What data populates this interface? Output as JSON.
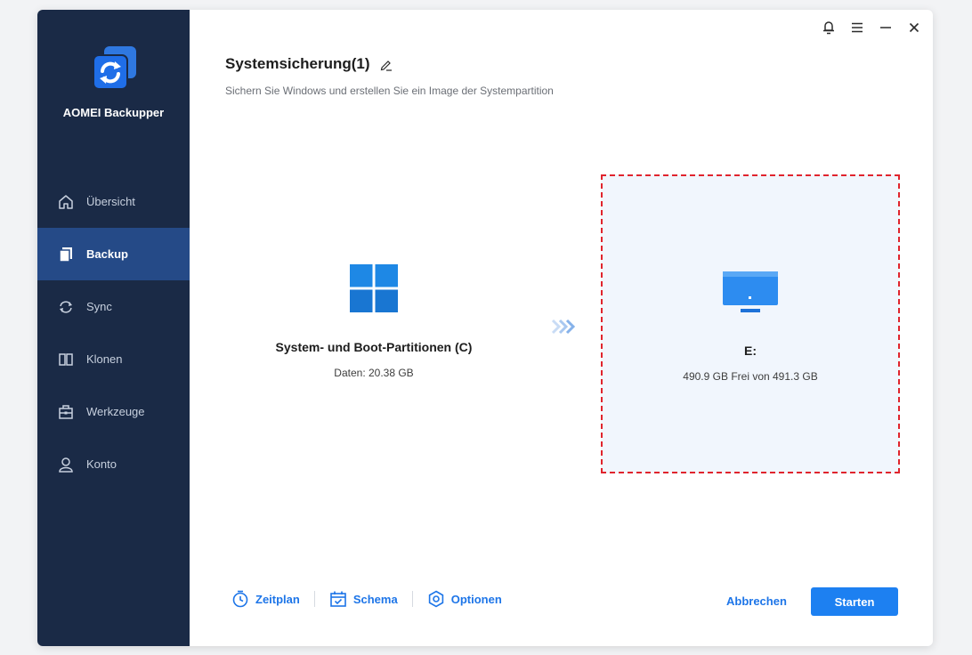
{
  "app": {
    "name": "AOMEI Backupper"
  },
  "sidebar": {
    "items": [
      {
        "label": "Übersicht",
        "icon": "home-icon",
        "active": false
      },
      {
        "label": "Backup",
        "icon": "backup-icon",
        "active": true
      },
      {
        "label": "Sync",
        "icon": "sync-icon",
        "active": false
      },
      {
        "label": "Klonen",
        "icon": "clone-icon",
        "active": false
      },
      {
        "label": "Werkzeuge",
        "icon": "toolbox-icon",
        "active": false
      },
      {
        "label": "Konto",
        "icon": "user-icon",
        "active": false
      }
    ]
  },
  "header": {
    "title": "Systemsicherung(1)",
    "subtitle": "Sichern Sie Windows und erstellen Sie ein Image der Systempartition"
  },
  "source": {
    "name": "System- und Boot-Partitionen (C)",
    "info": "Daten: 20.38 GB"
  },
  "destination": {
    "name": "E:",
    "info": "490.9 GB Frei von 491.3 GB"
  },
  "toolbar": {
    "schedule": "Zeitplan",
    "scheme": "Schema",
    "options": "Optionen",
    "cancel": "Abbrechen",
    "start": "Starten"
  },
  "colors": {
    "sidebar_bg": "#1a2a46",
    "sidebar_active": "#254a87",
    "accent": "#1d80f1",
    "dest_border": "#e0242d"
  }
}
